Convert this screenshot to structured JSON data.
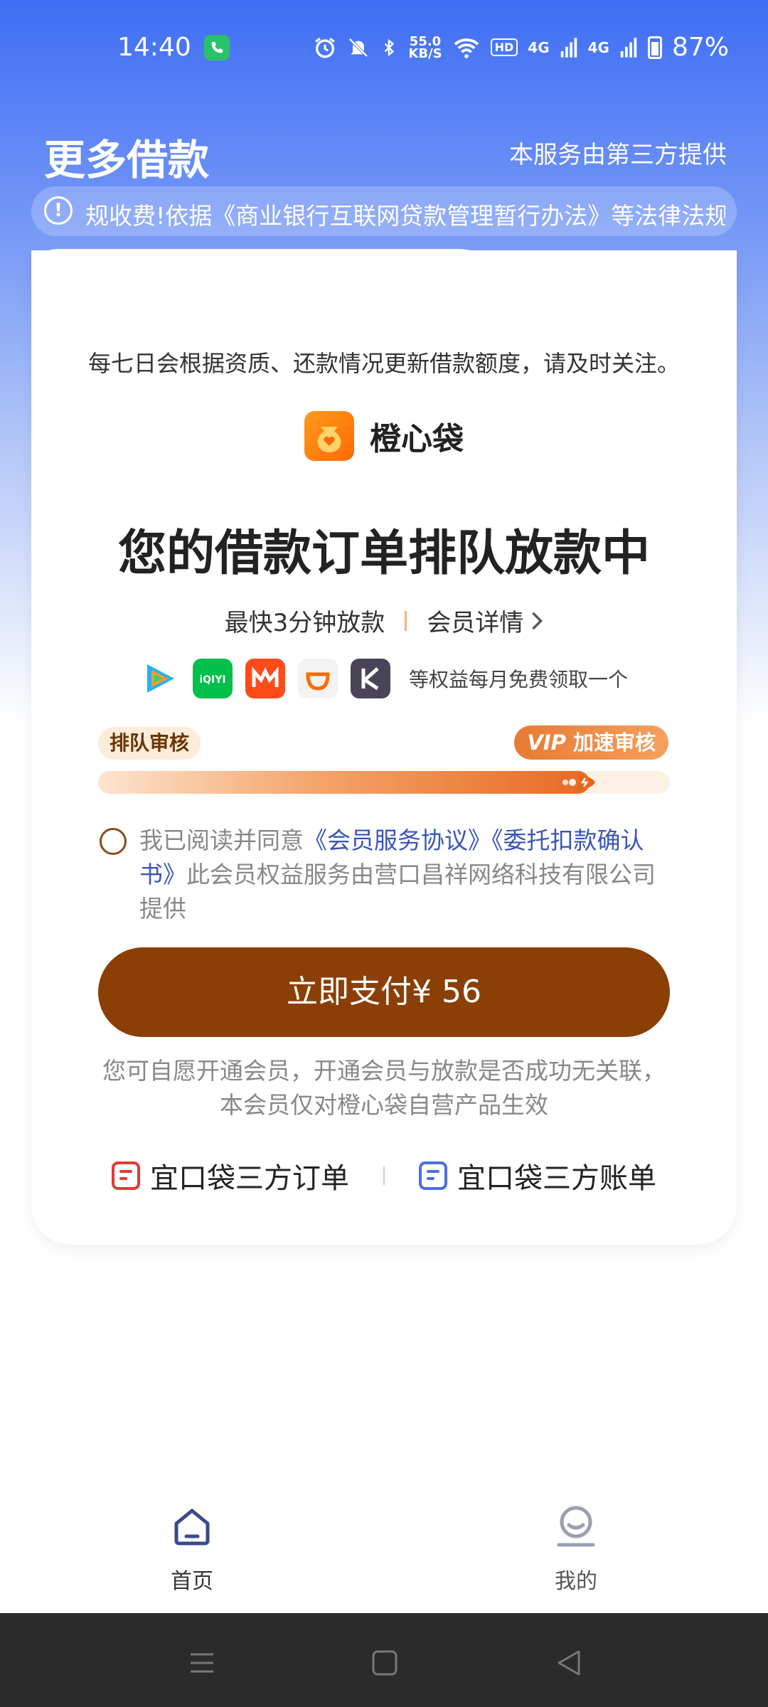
{
  "status_bar": {
    "time": "14:40",
    "net_speed_value": "55.0",
    "net_speed_unit": "KB/S",
    "hd_label": "HD",
    "signal1": "4G",
    "signal2": "4G",
    "battery": "87%"
  },
  "header": {
    "title": "更多借款",
    "subtitle": "本服务由第三方提供"
  },
  "notice": {
    "text": "规收费!依据《商业银行互联网贷款管理暂行办法》等法律法规"
  },
  "card": {
    "tip": "每七日会根据资质、还款情况更新借款额度，请及时关注。",
    "brand_name": "橙心袋",
    "headline": "您的借款订单排队放款中",
    "fastest": "最快3分钟放款",
    "member_detail": "会员详情",
    "perks_text": "等权益每月免费领取一个",
    "tag_queue": "排队审核",
    "tag_vip_prefix": "VIP",
    "tag_vip_label": "加速审核",
    "progress": 0.86,
    "agree_prefix": "我已阅读并同意",
    "agree_link1": "《会员服务协议》",
    "agree_link2": "《委托扣款确认书》",
    "agree_suffix": "此会员权益服务由营口昌祥网络科技有限公司提供",
    "pay_button": "立即支付¥ 56",
    "disclaimer": "您可自愿开通会员，开通会员与放款是否成功无关联，本会员仅对橙心袋自营产品生效",
    "link_orders": "宜口袋三方订单",
    "link_bills": "宜口袋三方账单"
  },
  "colors": {
    "accent_brown": "#8b3f05",
    "link_blue": "#3a55b8",
    "orders_icon": "#e53935",
    "bills_icon": "#4a6ee8"
  },
  "nav": {
    "home": "首页",
    "mine": "我的"
  }
}
